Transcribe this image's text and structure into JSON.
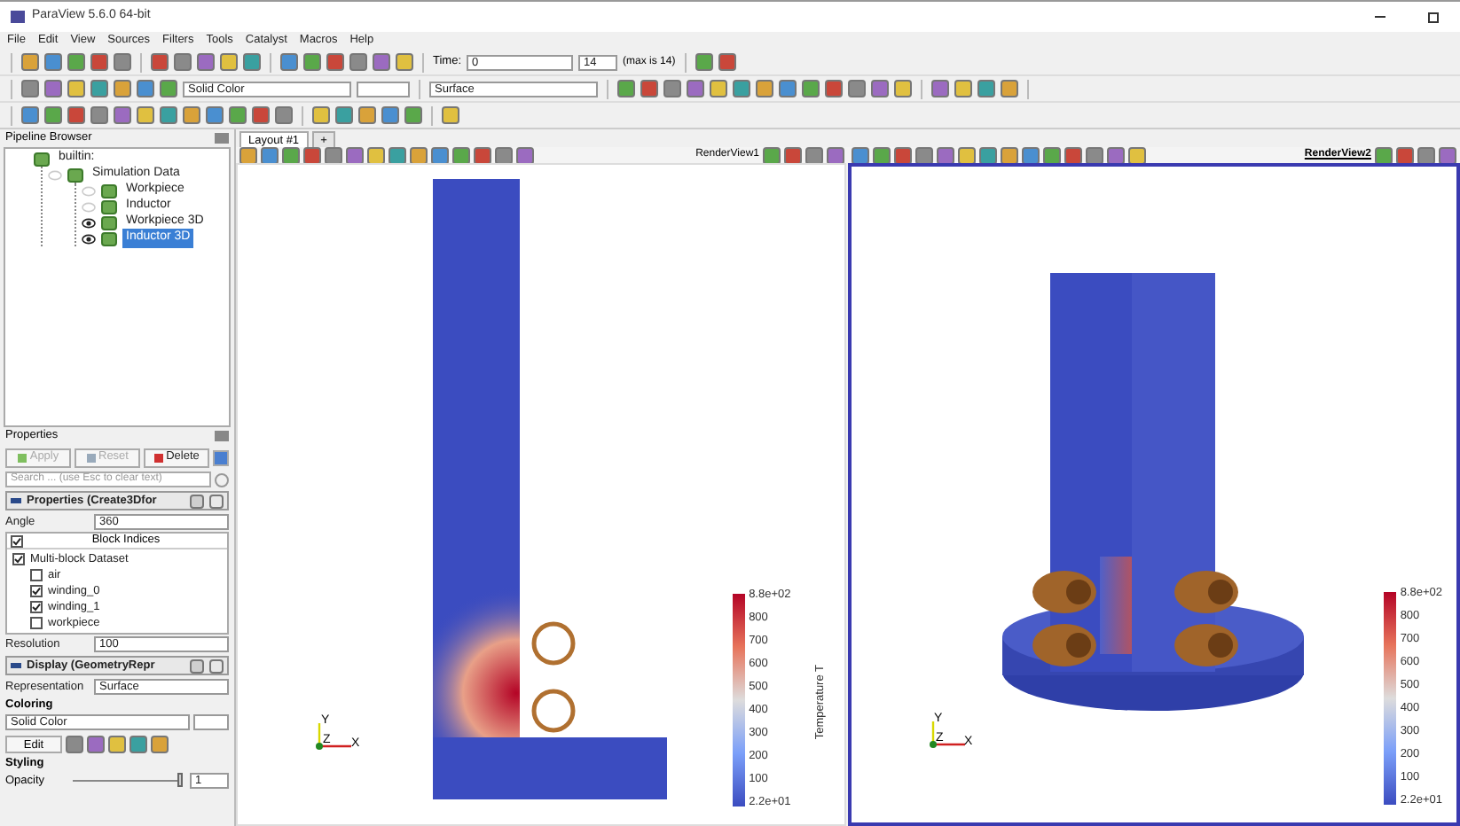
{
  "window": {
    "title": "ParaView 5.6.0 64-bit"
  },
  "menu": [
    "File",
    "Edit",
    "View",
    "Sources",
    "Filters",
    "Tools",
    "Catalyst",
    "Macros",
    "Help"
  ],
  "toolbar": {
    "time_label": "Time:",
    "time_value": "0",
    "step_value": "14",
    "max_label": "(max is 14)",
    "coloring_combo": "Solid Color",
    "representation_combo": "Surface"
  },
  "pipeline_browser": {
    "title": "Pipeline Browser",
    "items": [
      {
        "label": "builtin:",
        "selected": false,
        "children": [
          {
            "label": "Simulation Data",
            "visible": false,
            "selected": false,
            "children": [
              {
                "label": "Workpiece",
                "visible": false,
                "selected": false
              },
              {
                "label": "Inductor",
                "visible": false,
                "selected": false
              },
              {
                "label": "Workpiece 3D",
                "visible": true,
                "selected": false
              },
              {
                "label": "Inductor 3D",
                "visible": true,
                "selected": true
              }
            ]
          }
        ]
      }
    ]
  },
  "properties": {
    "title": "Properties",
    "buttons": [
      {
        "label": "Apply",
        "kind": "apply",
        "disabled": true
      },
      {
        "label": "Reset",
        "kind": "reset",
        "disabled": true
      },
      {
        "label": "Delete",
        "kind": "delete",
        "disabled": false
      }
    ],
    "search": {
      "placeholder": "Search ... (use Esc to clear text)"
    },
    "properties_header": "Properties (Create3Dfor",
    "angle": {
      "label": "Angle",
      "value": "360"
    },
    "block_indices": {
      "title": "Block Indices",
      "all_checked": true,
      "items": [
        {
          "label": "Multi-block Dataset",
          "checked": true,
          "children": [
            {
              "label": "air",
              "checked": false
            },
            {
              "label": "winding_0",
              "checked": true
            },
            {
              "label": "winding_1",
              "checked": true
            },
            {
              "label": "workpiece",
              "checked": false
            }
          ]
        }
      ]
    },
    "resolution": {
      "label": "Resolution",
      "value": "100"
    },
    "display_header": "Display (GeometryRepr",
    "representation": {
      "label": "Representation",
      "value": "Surface"
    },
    "coloring": {
      "title": "Coloring",
      "value": "Solid Color",
      "edit": "Edit"
    },
    "styling": {
      "title": "Styling",
      "opacity_label": "Opacity",
      "opacity_value": "1",
      "level": 1
    }
  },
  "layout_tabs": [
    {
      "label": "Layout #1",
      "selected": true
    },
    {
      "label": "+",
      "selected": false
    }
  ],
  "views": [
    {
      "title": "RenderView1",
      "selected": false,
      "kind": "slice",
      "colorbar": {
        "title": "Temperature T",
        "labels": [
          "8.8e+02",
          "800",
          "700",
          "600",
          "500",
          "400",
          "300",
          "200",
          "100",
          "2.2e+01"
        ]
      },
      "axes": [
        "Y",
        "Z",
        "X"
      ]
    },
    {
      "title": "RenderView2",
      "selected": true,
      "kind": "solid",
      "colorbar": {
        "labels": [
          "8.8e+02",
          "800",
          "700",
          "600",
          "500",
          "400",
          "300",
          "200",
          "100",
          "2.2e+01"
        ]
      },
      "axes": [
        "Y",
        "Z",
        "X"
      ]
    }
  ]
}
